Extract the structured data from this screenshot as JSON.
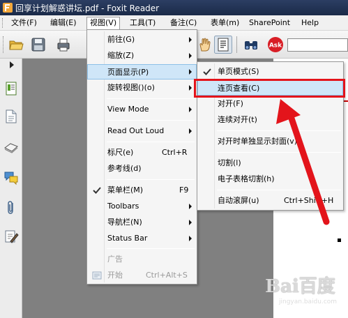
{
  "window": {
    "title": "回享计划解惑讲坛.pdf - Foxit Reader"
  },
  "menubar": [
    {
      "label": "文件(F)"
    },
    {
      "label": "编辑(E)"
    },
    {
      "label": "视图(V)"
    },
    {
      "label": "工具(T)"
    },
    {
      "label": "备注(C)"
    },
    {
      "label": "表单(m)"
    },
    {
      "label": "SharePoint"
    },
    {
      "label": "Help"
    }
  ],
  "toolbar": {
    "ask_label": "Ask",
    "search_value": ""
  },
  "view_menu": {
    "items": [
      {
        "label": "前往(G)",
        "submenu": true
      },
      {
        "label": "缩放(Z)",
        "submenu": true
      },
      {
        "label": "页面显示(P)",
        "submenu": true,
        "highlighted": true
      },
      {
        "label": "旋转视图()(o)",
        "submenu": true
      },
      {
        "label": "View Mode",
        "submenu": true
      },
      {
        "label": "Read Out Loud",
        "submenu": true
      },
      {
        "label": "标尺(e)",
        "shortcut": "Ctrl+R"
      },
      {
        "label": "参考线(d)"
      },
      {
        "label": "菜单栏(M)",
        "shortcut": "F9",
        "checked": true
      },
      {
        "label": "Toolbars",
        "submenu": true
      },
      {
        "label": "导航栏(N)",
        "submenu": true
      },
      {
        "label": "Status Bar",
        "submenu": true
      },
      {
        "label": "广告",
        "disabled": true
      },
      {
        "label": "开始",
        "shortcut": "Ctrl+Alt+S",
        "disabled": true
      }
    ]
  },
  "page_display_menu": {
    "items": [
      {
        "label": "单页模式(S)",
        "checked": true
      },
      {
        "label": "连页查看(C)",
        "highlighted": true
      },
      {
        "label": "对开(F)"
      },
      {
        "label": "连续对开(t)"
      },
      {
        "label": "对开时单独显示封面(v)"
      },
      {
        "label": "切割(l)"
      },
      {
        "label": "电子表格切割(h)"
      },
      {
        "label": "自动滚屏(u)",
        "shortcut": "Ctrl+Shift+H"
      }
    ]
  },
  "watermark": {
    "brand": "Bai百度",
    "url": "jingyan.baidu.com"
  },
  "colors": {
    "highlight": "#cfe6f8",
    "annotation_red": "#e3141b"
  }
}
